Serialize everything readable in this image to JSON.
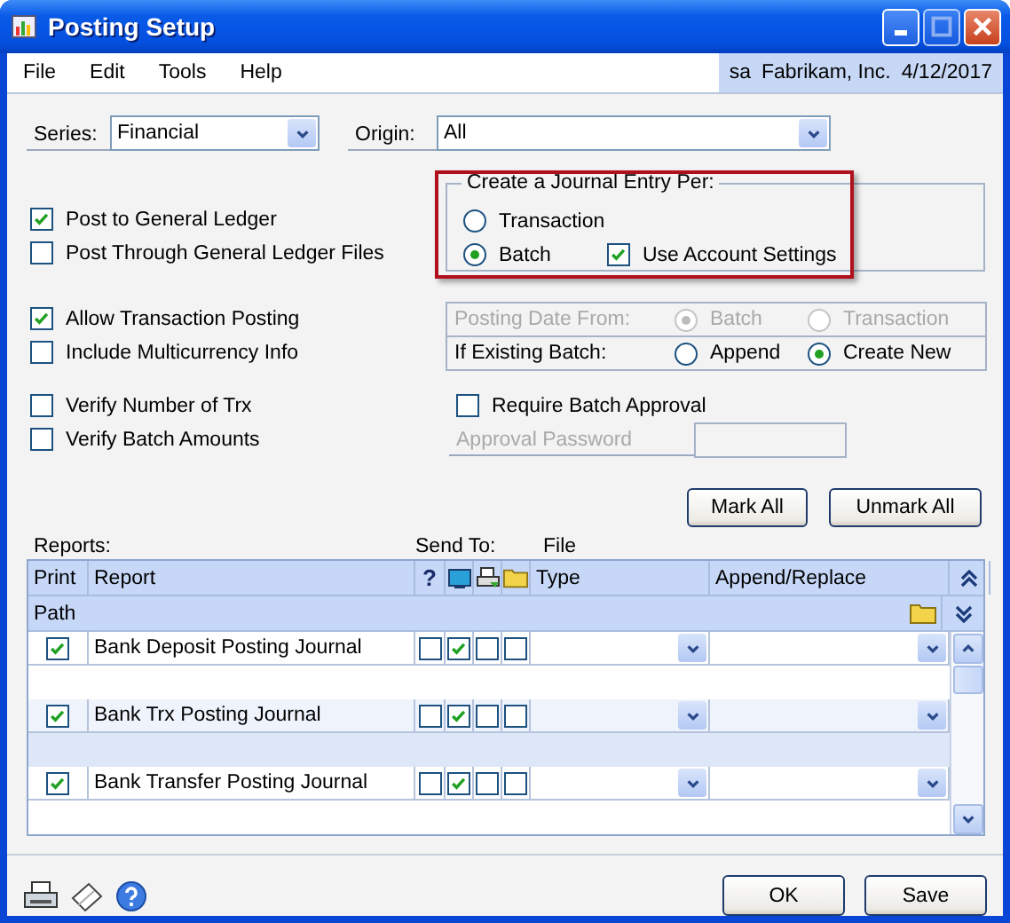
{
  "window": {
    "title": "Posting Setup"
  },
  "menu": [
    "File",
    "Edit",
    "Tools",
    "Help"
  ],
  "user_info": [
    "sa",
    "Fabrikam, Inc.",
    "4/12/2017"
  ],
  "series": {
    "label": "Series:",
    "value": "Financial"
  },
  "origin": {
    "label": "Origin:",
    "value": "All"
  },
  "ledger_options": [
    {
      "label": "Post to General Ledger",
      "checked": true
    },
    {
      "label": "Post Through General Ledger Files",
      "checked": false
    }
  ],
  "transaction_options": [
    {
      "label": "Allow Transaction Posting",
      "checked": true
    },
    {
      "label": "Include Multicurrency Info",
      "checked": false
    }
  ],
  "verify_options": [
    {
      "label": "Verify Number of Trx",
      "checked": false
    },
    {
      "label": "Verify Batch Amounts",
      "checked": false
    }
  ],
  "journal_entry": {
    "title": "Create a Journal Entry Per:",
    "highlighted": true,
    "options": [
      {
        "label": "Transaction",
        "selected": false
      },
      {
        "label": "Batch",
        "selected": true
      }
    ],
    "use_account_settings": {
      "label": "Use Account Settings",
      "checked": true
    }
  },
  "posting_date": {
    "label": "Posting Date From:",
    "disabled": true,
    "options": [
      {
        "label": "Batch",
        "selected": true
      },
      {
        "label": "Transaction",
        "selected": false
      }
    ]
  },
  "existing_batch": {
    "label": "If Existing Batch:",
    "options": [
      {
        "label": "Append",
        "selected": false
      },
      {
        "label": "Create New",
        "selected": true
      }
    ]
  },
  "require_batch_approval": {
    "label": "Require Batch Approval",
    "checked": false
  },
  "approval_password": {
    "label": "Approval Password",
    "disabled": true
  },
  "mark_buttons": [
    "Mark All",
    "Unmark All"
  ],
  "reports": {
    "label": "Reports:",
    "send_to_label": "Send To:",
    "file_label": "File",
    "columns": {
      "print": "Print",
      "report": "Report",
      "ask": "?",
      "type": "Type",
      "append": "Append/Replace"
    },
    "path_label": "Path",
    "rows": [
      {
        "print": true,
        "report": "Bank Deposit Posting Journal",
        "send_to": [
          false,
          true,
          false,
          false
        ]
      },
      {
        "print": true,
        "report": "Bank Trx Posting Journal",
        "send_to": [
          false,
          true,
          false,
          false
        ]
      },
      {
        "print": true,
        "report": "Bank Transfer Posting Journal",
        "send_to": [
          false,
          true,
          false,
          false
        ]
      }
    ]
  },
  "footer_buttons": [
    "OK",
    "Save"
  ]
}
